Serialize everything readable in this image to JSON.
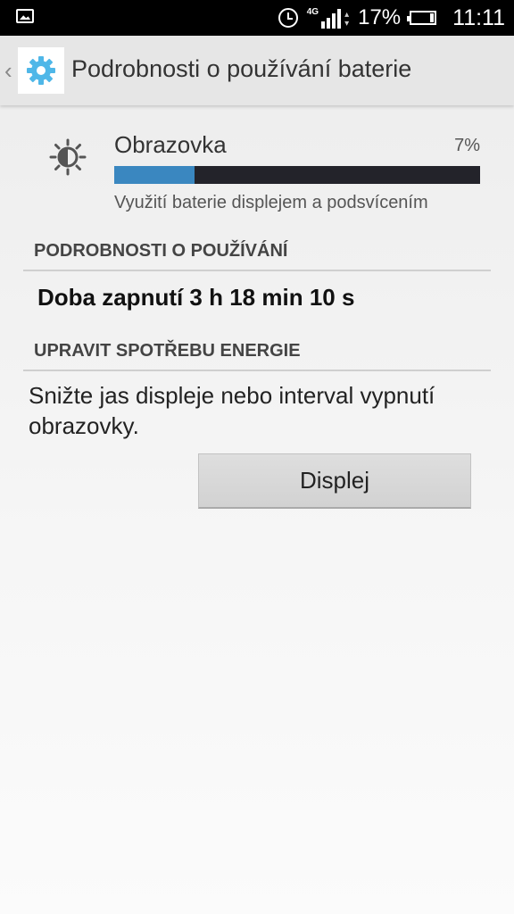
{
  "status_bar": {
    "network": "4G",
    "battery_percent": "17%",
    "battery_level": 0.17,
    "time": "11:11",
    "icons": [
      "image-icon",
      "alarm-icon",
      "signal-icon",
      "battery-icon"
    ]
  },
  "action_bar": {
    "title": "Podrobnosti o používání baterie",
    "icon": "settings-gear-icon",
    "accent": "#4fb7e8"
  },
  "entry": {
    "icon": "brightness-icon",
    "name": "Obrazovka",
    "percent": "7%",
    "usage_fraction": 0.22,
    "description": "Využití baterie displejem a podsvícením",
    "bar_color": "#3a87c0",
    "track_color": "#23232a"
  },
  "usage_section": {
    "header": "PODROBNOSTI O POUŽÍVÁNÍ",
    "time_on": "Doba zapnutí 3 h 18 min 10 s"
  },
  "power_section": {
    "header": "UPRAVIT SPOTŘEBU ENERGIE",
    "hint": "Snižte jas displeje nebo interval vypnutí obrazovky.",
    "button_label": "Displej"
  }
}
